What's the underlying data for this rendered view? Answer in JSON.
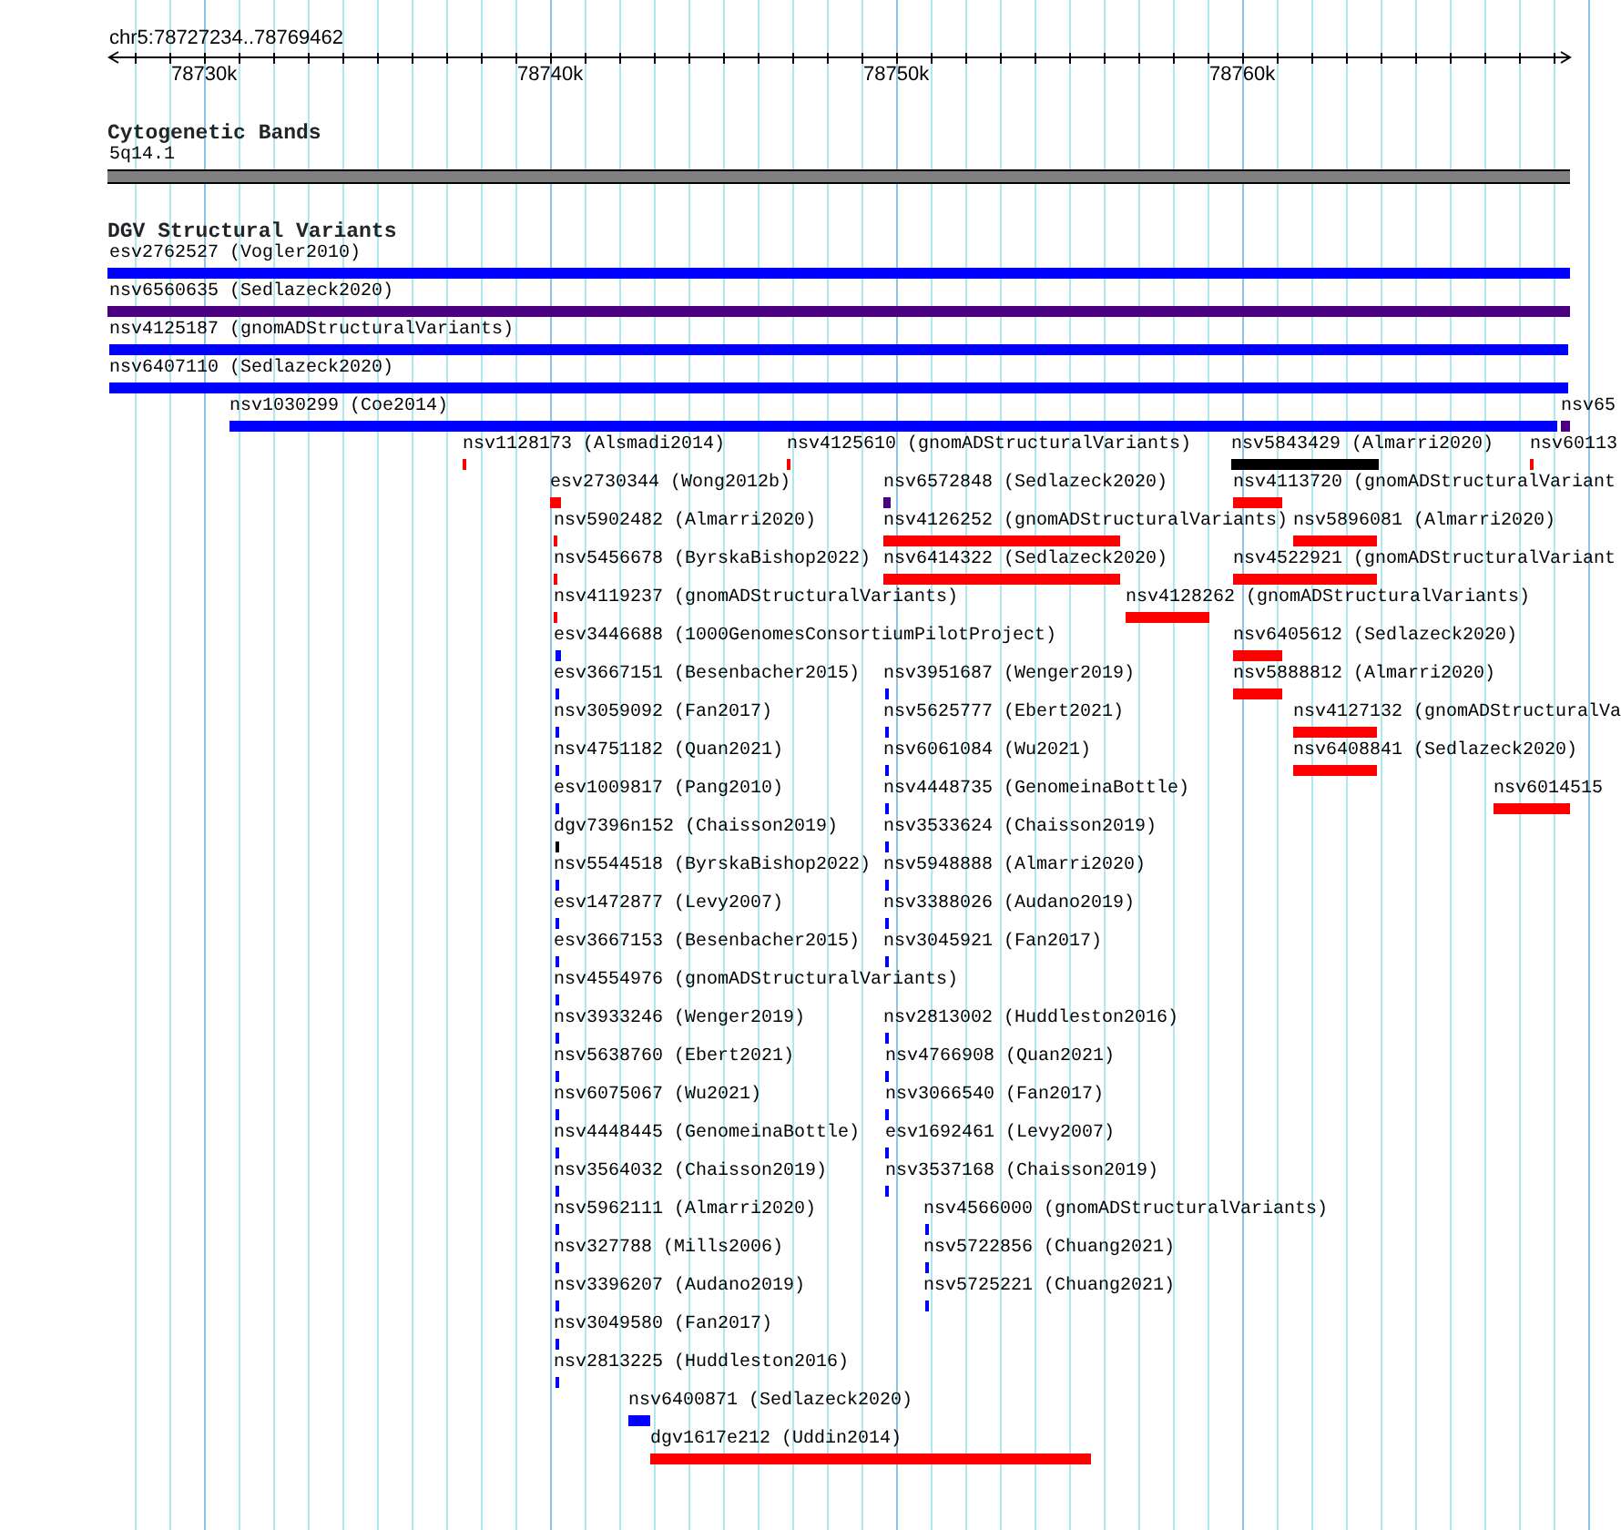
{
  "ruler": {
    "locus": "chr5:78727234..78769462",
    "ticks": [
      "78730k",
      "78740k",
      "78750k",
      "78760k"
    ]
  },
  "cytoband_track": {
    "title": "Cytogenetic Bands",
    "band": "5q14.1"
  },
  "dgv_track": {
    "title": "DGV Structural Variants",
    "features": [
      {
        "label": "esv2762527 (Vogler2010)",
        "color": "#0000ff"
      },
      {
        "label": "nsv6560635 (Sedlazeck2020)",
        "color": "#4b0082"
      },
      {
        "label": "nsv4125187 (gnomADStructuralVariants)",
        "color": "#0000ff"
      },
      {
        "label": "nsv6407110 (Sedlazeck2020)",
        "color": "#0000ff"
      },
      {
        "label": "nsv1030299 (Coe2014)",
        "color": "#0000ff"
      },
      {
        "label": "nsv65",
        "color": "#4b0082"
      },
      {
        "label": "nsv1128173 (Alsmadi2014)",
        "color": "#ff0000"
      },
      {
        "label": "nsv4125610 (gnomADStructuralVariants)",
        "color": "#ff0000"
      },
      {
        "label": "nsv5843429 (Almarri2020)",
        "color": "#000000"
      },
      {
        "label": "nsv60113",
        "color": "#ff0000"
      },
      {
        "label": "esv2730344 (Wong2012b)",
        "color": "#ff0000"
      },
      {
        "label": "nsv6572848 (Sedlazeck2020)",
        "color": "#4b0082"
      },
      {
        "label": "nsv4113720 (gnomADStructuralVariant",
        "color": "#ff0000"
      },
      {
        "label": "nsv5902482 (Almarri2020)",
        "color": "#ff0000"
      },
      {
        "label": "nsv4126252 (gnomADStructuralVariants)",
        "color": "#ff0000"
      },
      {
        "label": "nsv5896081 (Almarri2020)",
        "color": "#ff0000"
      },
      {
        "label": "nsv5456678 (ByrskaBishop2022)",
        "color": "#ff0000"
      },
      {
        "label": "nsv6414322 (Sedlazeck2020)",
        "color": "#ff0000"
      },
      {
        "label": "nsv4522921 (gnomADStructuralVariant",
        "color": "#ff0000"
      },
      {
        "label": "nsv4119237 (gnomADStructuralVariants)",
        "color": "#ff0000"
      },
      {
        "label": "nsv4128262 (gnomADStructuralVariants)",
        "color": "#ff0000"
      },
      {
        "label": "esv3446688 (1000GenomesConsortiumPilotProject)",
        "color": "#0000ff"
      },
      {
        "label": "nsv6405612 (Sedlazeck2020)",
        "color": "#ff0000"
      },
      {
        "label": "esv3667151 (Besenbacher2015)",
        "color": "#0000ff"
      },
      {
        "label": "nsv3951687 (Wenger2019)",
        "color": "#0000ff"
      },
      {
        "label": "nsv5888812 (Almarri2020)",
        "color": "#ff0000"
      },
      {
        "label": "nsv3059092 (Fan2017)",
        "color": "#0000ff"
      },
      {
        "label": "nsv5625777 (Ebert2021)",
        "color": "#0000ff"
      },
      {
        "label": "nsv4127132 (gnomADStructuralVa",
        "color": "#ff0000"
      },
      {
        "label": "nsv4751182 (Quan2021)",
        "color": "#0000ff"
      },
      {
        "label": "nsv6061084 (Wu2021)",
        "color": "#0000ff"
      },
      {
        "label": "nsv6408841 (Sedlazeck2020)",
        "color": "#ff0000"
      },
      {
        "label": "esv1009817 (Pang2010)",
        "color": "#0000ff"
      },
      {
        "label": "nsv4448735 (GenomeinaBottle)",
        "color": "#0000ff"
      },
      {
        "label": "nsv6014515",
        "color": "#ff0000"
      },
      {
        "label": "dgv7396n152 (Chaisson2019)",
        "color": "#000000"
      },
      {
        "label": "nsv3533624 (Chaisson2019)",
        "color": "#0000ff"
      },
      {
        "label": "nsv5544518 (ByrskaBishop2022)",
        "color": "#0000ff"
      },
      {
        "label": "nsv5948888 (Almarri2020)",
        "color": "#0000ff"
      },
      {
        "label": "esv1472877 (Levy2007)",
        "color": "#0000ff"
      },
      {
        "label": "nsv3388026 (Audano2019)",
        "color": "#0000ff"
      },
      {
        "label": "esv3667153 (Besenbacher2015)",
        "color": "#0000ff"
      },
      {
        "label": "nsv3045921 (Fan2017)",
        "color": "#0000ff"
      },
      {
        "label": "nsv4554976 (gnomADStructuralVariants)",
        "color": "#0000ff"
      },
      {
        "label": "nsv3933246 (Wenger2019)",
        "color": "#0000ff"
      },
      {
        "label": "nsv2813002 (Huddleston2016)",
        "color": "#0000ff"
      },
      {
        "label": "nsv5638760 (Ebert2021)",
        "color": "#0000ff"
      },
      {
        "label": "nsv4766908 (Quan2021)",
        "color": "#0000ff"
      },
      {
        "label": "nsv6075067 (Wu2021)",
        "color": "#0000ff"
      },
      {
        "label": "nsv3066540 (Fan2017)",
        "color": "#0000ff"
      },
      {
        "label": "nsv4448445 (GenomeinaBottle)",
        "color": "#0000ff"
      },
      {
        "label": "esv1692461 (Levy2007)",
        "color": "#0000ff"
      },
      {
        "label": "nsv3564032 (Chaisson2019)",
        "color": "#0000ff"
      },
      {
        "label": "nsv3537168 (Chaisson2019)",
        "color": "#0000ff"
      },
      {
        "label": "nsv5962111 (Almarri2020)",
        "color": "#0000ff"
      },
      {
        "label": "nsv4566000 (gnomADStructuralVariants)",
        "color": "#0000ff"
      },
      {
        "label": "nsv327788 (Mills2006)",
        "color": "#0000ff"
      },
      {
        "label": "nsv5722856 (Chuang2021)",
        "color": "#0000ff"
      },
      {
        "label": "nsv3396207 (Audano2019)",
        "color": "#0000ff"
      },
      {
        "label": "nsv5725221 (Chuang2021)",
        "color": "#0000ff"
      },
      {
        "label": "nsv3049580 (Fan2017)",
        "color": "#0000ff"
      },
      {
        "label": "nsv2813225 (Huddleston2016)",
        "color": "#0000ff"
      },
      {
        "label": "nsv6400871 (Sedlazeck2020)",
        "color": "#0000ff"
      },
      {
        "label": "dgv1617e212 (Uddin2014)",
        "color": "#ff0000"
      }
    ]
  }
}
